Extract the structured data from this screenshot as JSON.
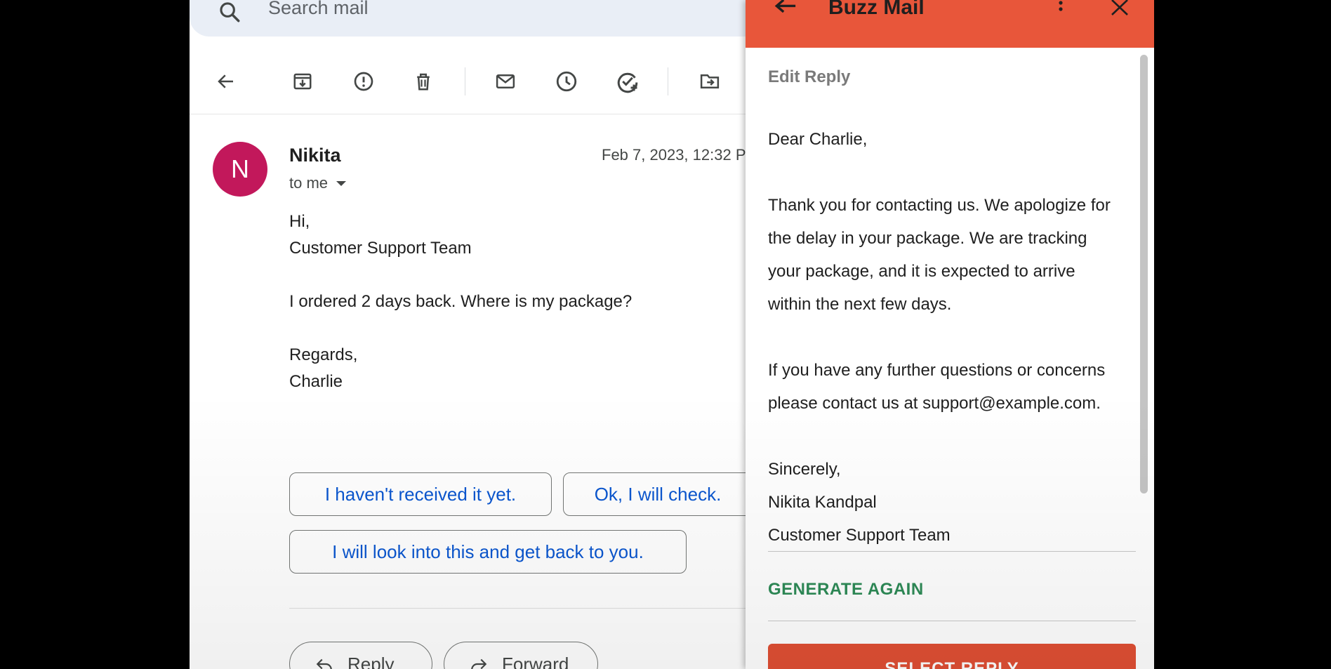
{
  "search": {
    "placeholder": "Search mail"
  },
  "toolbar": {
    "back": "arrow-left-icon",
    "archive": "archive-icon",
    "spam": "report-spam-icon",
    "delete": "trash-icon",
    "unread": "mark-unread-icon",
    "snooze": "snooze-icon",
    "task": "add-task-icon",
    "move": "move-to-icon"
  },
  "email": {
    "avatar_letter": "N",
    "avatar_color": "#c2185b",
    "sender": "Nikita",
    "recipient": "to me",
    "date": "Feb 7, 2023, 12:32 P",
    "body": [
      "Hi,",
      "Customer Support Team",
      "I ordered 2 days back. Where is my package?",
      "Regards,",
      "Charlie"
    ]
  },
  "smart_replies": [
    "I haven't received it yet.",
    "Ok, I will check.",
    "I will look into this and get back to you."
  ],
  "actions": {
    "reply": "Reply",
    "forward": "Forward"
  },
  "panel": {
    "title": "Buzz Mail",
    "header_color": "#e8563a",
    "section_title": "Edit Reply",
    "reply_lines": [
      "Dear Charlie,",
      "Thank you for contacting us. We apologize for",
      "the delay in your package. We are tracking",
      "your package, and it is expected to arrive",
      "within the next few days.",
      "If you have any further questions or concerns",
      "please contact us at support@example.com.",
      "Sincerely,",
      "Nikita Kandpal",
      "Customer Support Team"
    ],
    "generate_again": "GENERATE AGAIN",
    "select_reply": "SELECT REPLY"
  }
}
